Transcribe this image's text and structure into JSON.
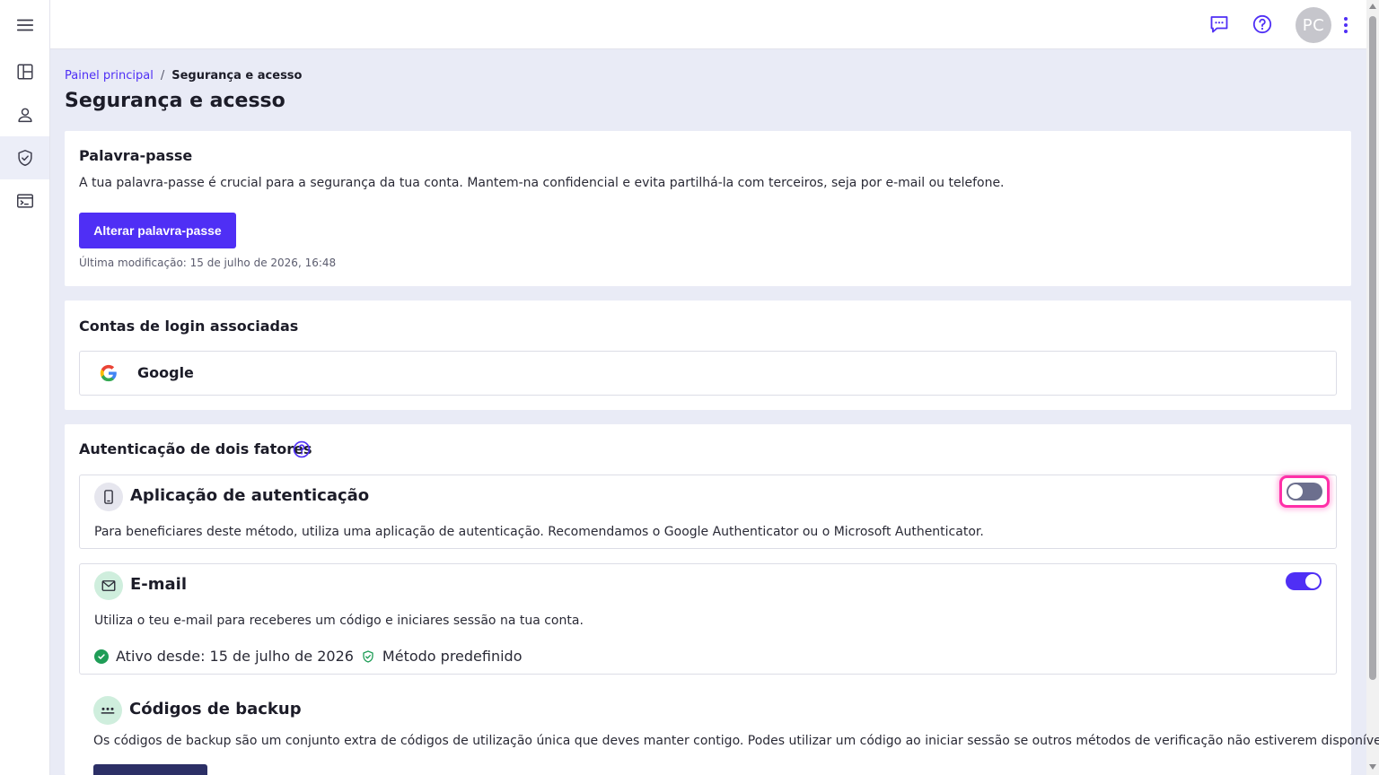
{
  "sidebar": {
    "items": [
      {
        "name": "menu",
        "icon": "hamburger-menu-icon"
      },
      {
        "name": "dashboard",
        "icon": "dashboard-icon"
      },
      {
        "name": "profile",
        "icon": "person-icon"
      },
      {
        "name": "security",
        "icon": "shield-check-icon",
        "active": true
      },
      {
        "name": "terminal",
        "icon": "terminal-icon"
      }
    ]
  },
  "topbar": {
    "feedback_icon": "chat-icon",
    "help_icon": "help-circle-icon",
    "avatar_initials": "PC",
    "more_icon": "kebab-menu-icon"
  },
  "breadcrumb": {
    "parent": "Painel principal",
    "separator": "/",
    "current": "Segurança e acesso"
  },
  "page_title": "Segurança e acesso",
  "password_card": {
    "title": "Palavra-passe",
    "description": "A tua palavra-passe é crucial para a segurança da tua conta. Mantem-na confidencial e evita partilhá-la com terceiros, seja por e-mail ou telefone.",
    "button_label": "Alterar palavra-passe",
    "last_modified": "Última modificação: 15 de julho de 2026, 16:48"
  },
  "linked_accounts": {
    "title": "Contas de login associadas",
    "accounts": [
      {
        "provider": "Google",
        "icon": "google-logo"
      }
    ]
  },
  "two_factor": {
    "title": "Autenticação de dois fatores",
    "help_icon": "help-circle-icon",
    "methods": [
      {
        "title": "Aplicação de autenticação",
        "icon": "smartphone-icon",
        "description": "Para beneficiares deste método, utiliza uma aplicação de autenticação. Recomendamos o Google Authenticator ou o Microsoft Authenticator.",
        "enabled": false
      },
      {
        "title": "E-mail",
        "icon": "mail-icon",
        "description": "Utiliza o teu e-mail para receberes um código e iniciares sessão na tua conta.",
        "enabled": true,
        "active_since": "Ativo desde: 15 de julho de 2026",
        "default_label": "Método predefinido"
      },
      {
        "title": "Códigos de backup",
        "icon": "dots-icon",
        "description": "Os códigos de backup são um conjunto extra de códigos de utilização única que deves manter contigo. Podes utilizar um código ao iniciar sessão se outros métodos de verificação não estiverem disponíveis."
      }
    ]
  },
  "colors": {
    "accent": "#4f2ff5",
    "background": "#e9ebf6",
    "success": "#1f9d57",
    "focus": "#ff2fa8"
  }
}
